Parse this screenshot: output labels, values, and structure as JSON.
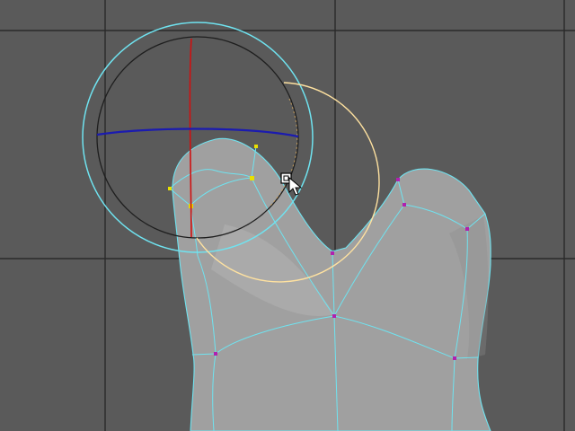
{
  "viewport": {
    "view": "perspective",
    "background_color": "#5a5a5a",
    "grid_color": "#2a2a2a"
  },
  "mesh": {
    "shape": "tooth",
    "face_color": "#a0a0a0",
    "edge_color": "#6fe3f0",
    "vertex_colors": {
      "default": "#b020b0",
      "selected": "#e8e000"
    },
    "selected_vertex_count": 4
  },
  "rotate_manipulator": {
    "axes": [
      {
        "axis": "x",
        "color": "#d01010"
      },
      {
        "axis": "y",
        "color": "#ffe2a0"
      },
      {
        "axis": "z",
        "color": "#1b1bb0"
      }
    ],
    "view_ring_color": "#6fe3f0",
    "trackball_color": "#1e1e1e"
  },
  "cursor": {
    "icon": "rotate-tool-cursor-icon"
  }
}
